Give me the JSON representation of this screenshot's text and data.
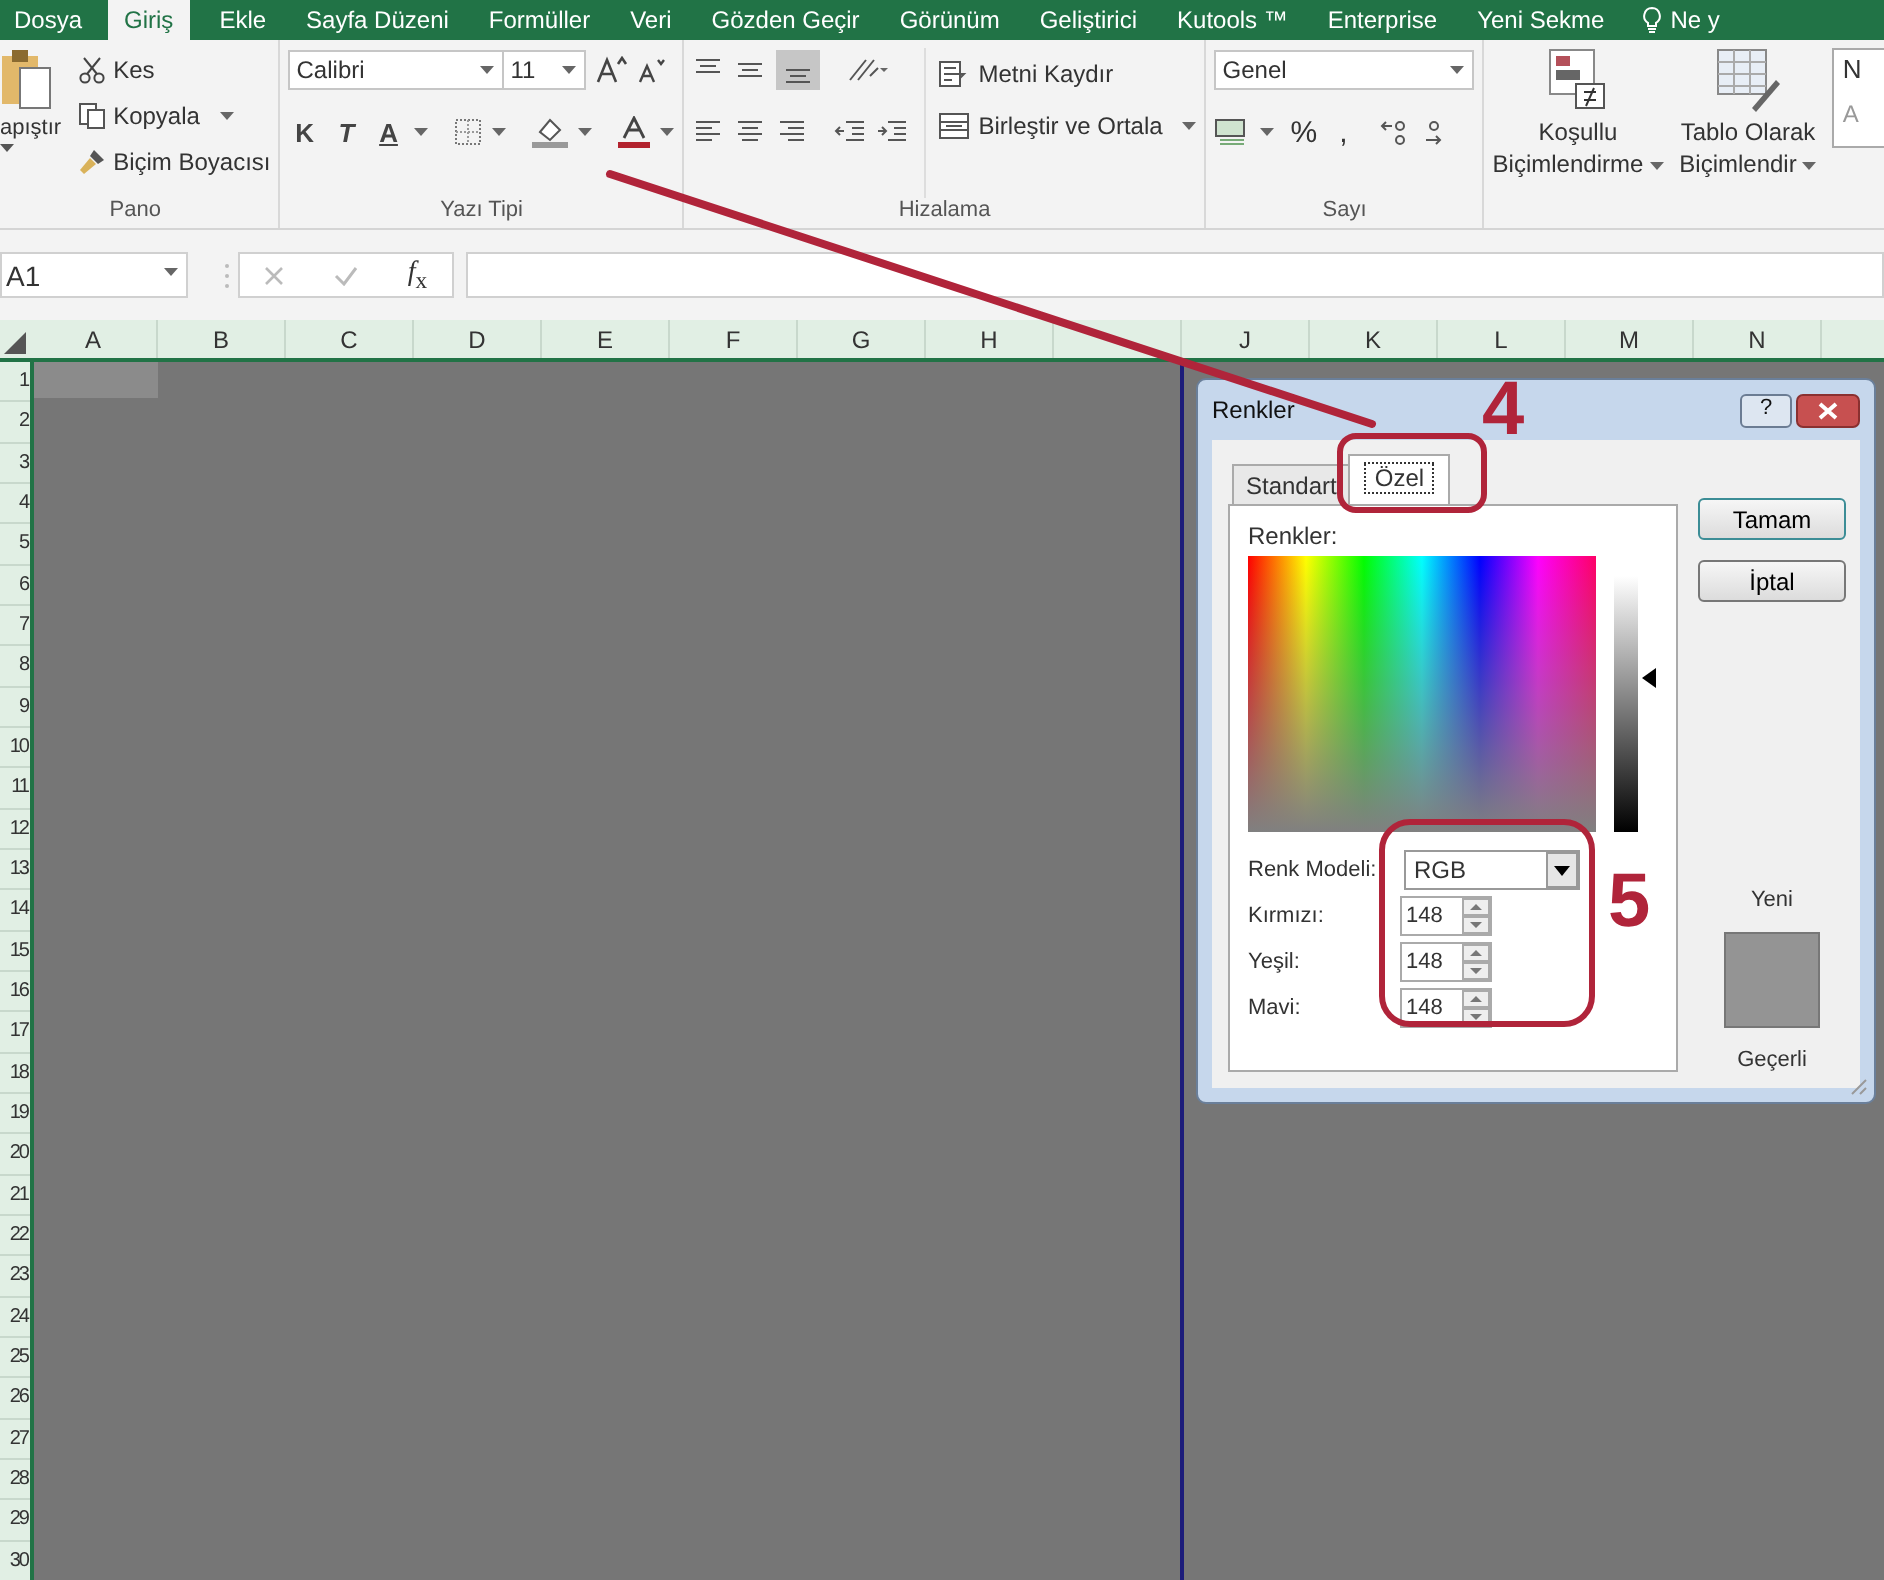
{
  "ribbon_tabs": [
    {
      "label": "Dosya",
      "selected": false
    },
    {
      "label": "Giriş",
      "selected": true
    },
    {
      "label": "Ekle",
      "selected": false
    },
    {
      "label": "Sayfa Düzeni",
      "selected": false
    },
    {
      "label": "Formüller",
      "selected": false
    },
    {
      "label": "Veri",
      "selected": false
    },
    {
      "label": "Gözden Geçir",
      "selected": false
    },
    {
      "label": "Görünüm",
      "selected": false
    },
    {
      "label": "Geliştirici",
      "selected": false
    },
    {
      "label": "Kutools ™",
      "selected": false
    },
    {
      "label": "Enterprise",
      "selected": false
    },
    {
      "label": "Yeni Sekme",
      "selected": false
    }
  ],
  "tell_me": "Ne y",
  "clipboard": {
    "paste": "apıştır",
    "cut": "Kes",
    "copy": "Kopyala",
    "format_painter": "Biçim Boyacısı",
    "group": "Pano"
  },
  "font": {
    "name": "Calibri",
    "size": "11",
    "bold": "K",
    "italic": "T",
    "underline": "A",
    "group": "Yazı Tipi"
  },
  "alignment": {
    "wrap": "Metni Kaydır",
    "merge": "Birleştir ve Ortala",
    "group": "Hizalama"
  },
  "number": {
    "format": "Genel",
    "percent": "%",
    "comma": ",",
    "group": "Sayı"
  },
  "styles": {
    "conditional": [
      "Koşullu",
      "Biçimlendirme"
    ],
    "table": [
      "Tablo Olarak",
      "Biçimlendir"
    ],
    "gallery": [
      "N",
      "A"
    ]
  },
  "formula_bar": {
    "name_box": "A1",
    "fx": "*f*$_{x}$"
  },
  "columns": [
    "A",
    "B",
    "C",
    "D",
    "E",
    "F",
    "G",
    "H"
  ],
  "columns_right": [
    "J",
    "K",
    "L",
    "M",
    "N"
  ],
  "rows": [
    "1",
    "2",
    "3",
    "4",
    "5",
    "6",
    "7",
    "8",
    "9",
    "10",
    "11",
    "12",
    "13",
    "14",
    "15",
    "16",
    "17",
    "18",
    "19",
    "20",
    "21",
    "22",
    "23",
    "24",
    "25",
    "26",
    "27",
    "28",
    "29",
    "30"
  ],
  "dialog": {
    "title": "Renkler",
    "help": "?",
    "tabs": [
      {
        "label": "Standart",
        "selected": false
      },
      {
        "label": "Özel",
        "selected": true
      }
    ],
    "colors_label": "Renkler:",
    "luminance": {
      "level": 0.6
    },
    "model_label": "Renk Modeli:",
    "model": "RGB",
    "channels": [
      {
        "label": "Kırmızı:",
        "value": "148"
      },
      {
        "label": "Yeşil:",
        "value": "148"
      },
      {
        "label": "Mavi:",
        "value": "148"
      }
    ],
    "ok": "Tamam",
    "cancel": "İptal",
    "new_label": "Yeni",
    "current_label": "Geçerli"
  },
  "annotations": [
    {
      "label": "4"
    },
    {
      "label": "5"
    }
  ]
}
